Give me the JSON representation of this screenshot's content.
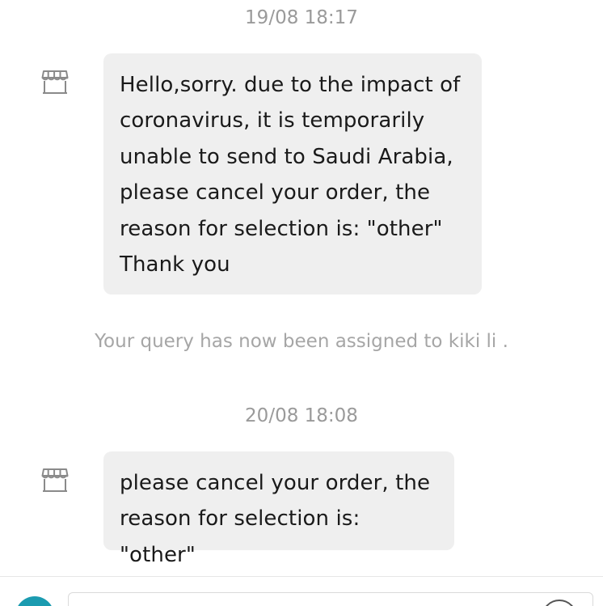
{
  "messages": [
    {
      "timestamp": "19/08 18:17",
      "sender_icon": "shop-icon",
      "text": "Hello,sorry. due to the impact of\ncoronavirus, it is temporarily\nunable to send to Saudi Arabia,\nplease cancel your order, the\nreason for selection is: \"other\"\nThank you"
    },
    {
      "timestamp": "20/08 18:08",
      "sender_icon": "shop-icon",
      "text": "please cancel your order, the\nreason for selection is: \"other\""
    }
  ],
  "system_note": "Your query has now been assigned to kiki li .",
  "composer": {
    "avatar_color": "#1b9bb0"
  },
  "colors": {
    "bubble_background": "#efefef",
    "timestamp_text": "#9a9a9a",
    "note_text": "#a6a6a6",
    "message_text": "#1a1a1a"
  }
}
